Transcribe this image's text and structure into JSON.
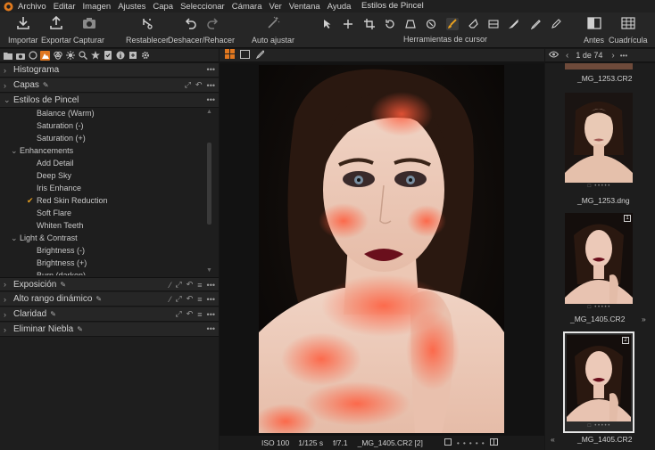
{
  "menu": {
    "items": [
      "Archivo",
      "Editar",
      "Imagen",
      "Ajustes",
      "Capa",
      "Seleccionar",
      "Cámara",
      "Ver",
      "Ventana",
      "Ayuda"
    ],
    "window_title": "Estilos de Pincel"
  },
  "toolbar": {
    "import": "Importar",
    "export": "Exportar",
    "capture": "Capturar",
    "reset": "Restablecer",
    "undo_redo": "Deshacer/Rehacer",
    "auto_adjust": "Auto ajustar",
    "cursor_tools": "Herramientas de cursor",
    "before": "Antes",
    "grid": "Cuadrícula"
  },
  "left_panel": {
    "histogram": "Histograma",
    "layers": "Capas",
    "brush_styles": "Estilos de Pincel",
    "brush_items_top": [
      "Balance (Warm)",
      "Saturation (-)",
      "Saturation (+)"
    ],
    "group_enhancements": "Enhancements",
    "enhancements": [
      "Add Detail",
      "Deep Sky",
      "Iris Enhance",
      "Red Skin Reduction",
      "Soft Flare",
      "Whiten Teeth"
    ],
    "selected_item": "Red Skin Reduction",
    "group_light": "Light & Contrast",
    "light_items": [
      "Brightness (-)",
      "Brightness (+)",
      "Burn (darken)"
    ],
    "exposure": "Exposición",
    "hdr": "Alto rango dinámico",
    "clarity": "Claridad",
    "haze": "Eliminar Niebla"
  },
  "status": {
    "iso": "ISO 100",
    "shutter": "1/125 s",
    "aperture": "f/7.1",
    "file": "_MG_1405.CR2 [2]"
  },
  "browser": {
    "count": "1 de 74",
    "thumbs": [
      {
        "caption": "_MG_1253.CR2"
      },
      {
        "caption": "_MG_1253.dng"
      },
      {
        "caption": "_MG_1405.CR2",
        "badge": "1"
      },
      {
        "caption": "_MG_1405.CR2",
        "badge": "2"
      }
    ]
  },
  "colors": {
    "accent": "#e0771f",
    "check": "#e8a020",
    "panel": "#1e1e1e"
  }
}
